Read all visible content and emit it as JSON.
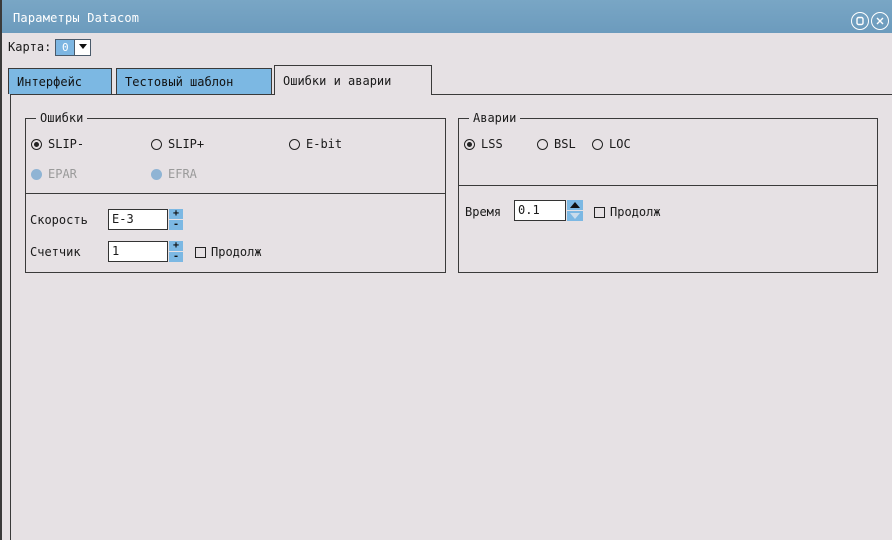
{
  "window": {
    "title": "Параметры Datacom",
    "title_buttons": [
      "restore-icon",
      "close-icon"
    ]
  },
  "card": {
    "label": "Карта:",
    "value": "0"
  },
  "tabs": [
    {
      "label": "Интерфейс",
      "active": false
    },
    {
      "label": "Тестовый шаблон",
      "active": false
    },
    {
      "label": "Ошибки и аварии",
      "active": true
    }
  ],
  "errors": {
    "title": "Ошибки",
    "radios": [
      {
        "label": "SLIP-",
        "checked": true,
        "disabled": false
      },
      {
        "label": "SLIP+",
        "checked": false,
        "disabled": false
      },
      {
        "label": "E-bit",
        "checked": false,
        "disabled": false
      },
      {
        "label": "EPAR",
        "checked": false,
        "disabled": true
      },
      {
        "label": "EFRA",
        "checked": false,
        "disabled": true
      }
    ],
    "speed_label": "Скорость",
    "speed_value": "E-3",
    "counter_label": "Счетчик",
    "counter_value": "1",
    "continuous_label": "Продолж"
  },
  "alarms": {
    "title": "Аварии",
    "radios": [
      {
        "label": "LSS",
        "checked": true
      },
      {
        "label": "BSL",
        "checked": false
      },
      {
        "label": "LOC",
        "checked": false
      }
    ],
    "time_label": "Время",
    "time_value": "0.1",
    "continuous_label": "Продолж"
  },
  "colors": {
    "titlebar": "#6c9bbd",
    "tab_inactive": "#7cb8e3",
    "background": "#e6e1e4"
  }
}
